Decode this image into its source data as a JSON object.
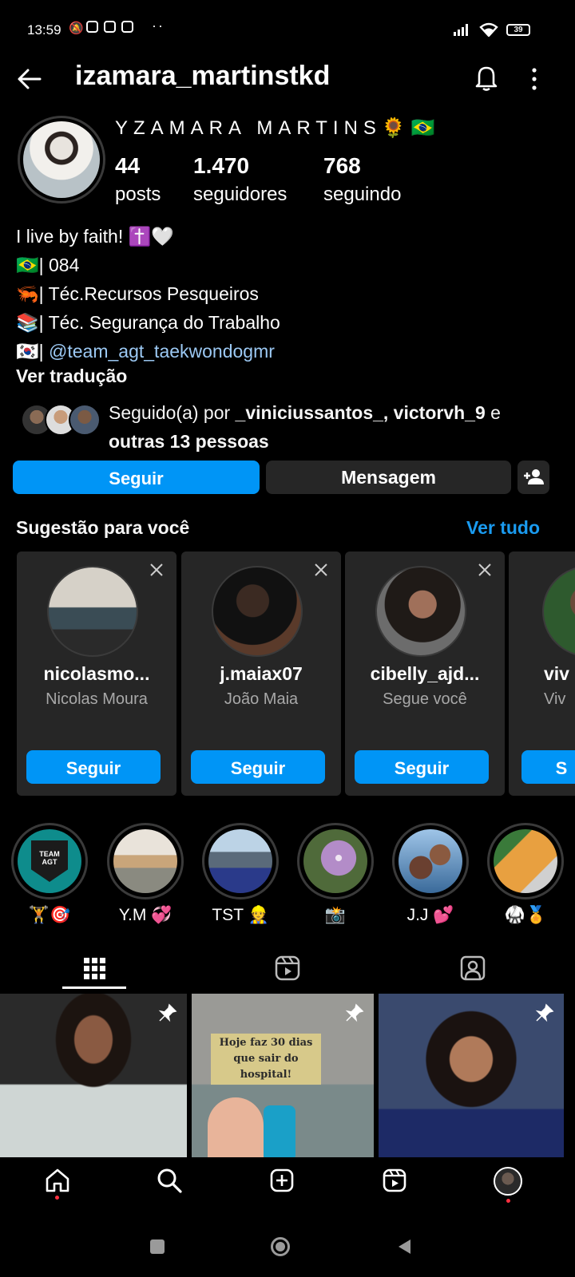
{
  "status": {
    "time": "13:59",
    "battery": "39",
    "dots": "··"
  },
  "header": {
    "username": "izamara_martinstkd"
  },
  "profile": {
    "display_name": "YZAMARA MARTINS🌻🇧🇷",
    "stats": [
      {
        "value": "44",
        "label": "posts"
      },
      {
        "value": "1.470",
        "label": "seguidores"
      },
      {
        "value": "768",
        "label": "seguindo"
      }
    ],
    "bio": {
      "line1": "I live by faith! ✝️🤍",
      "line2": "🇧🇷| 084",
      "line3": "🦐| Téc.Recursos Pesqueiros",
      "line4": "📚| Téc. Segurança do Trabalho",
      "line5_prefix": "🇰🇷| ",
      "line5_link": "@team_agt_taekwondogmr"
    },
    "translate": "Ver tradução",
    "followed_by": {
      "prefix": "Seguido(a) por ",
      "names": "_viniciussantos_, victorvh_9",
      "joiner": " e ",
      "others": "outras 13 pessoas"
    }
  },
  "actions": {
    "follow": "Seguir",
    "message": "Mensagem"
  },
  "suggestions": {
    "title": "Sugestão para você",
    "see_all": "Ver tudo",
    "cards": [
      {
        "username": "nicolasmo...",
        "subtitle": "Nicolas Moura",
        "button": "Seguir"
      },
      {
        "username": "j.maiax07",
        "subtitle": "João Maia",
        "button": "Seguir"
      },
      {
        "username": "cibelly_ajd...",
        "subtitle": "Segue você",
        "button": "Seguir"
      },
      {
        "username": "viv",
        "subtitle": "Viv",
        "button": "S"
      }
    ]
  },
  "highlights": [
    {
      "label": "🏋️🎯",
      "logo": "TEAM AGT"
    },
    {
      "label": "Y.M 💞"
    },
    {
      "label": "TST 👷"
    },
    {
      "label": "📸"
    },
    {
      "label": "J.J 💕"
    },
    {
      "label": "🥋🏅"
    }
  ],
  "posts": [
    {
      "overlay": ""
    },
    {
      "overlay": "Hoje faz 30 dias que sair do hospital!"
    },
    {
      "overlay": ""
    }
  ],
  "colors": {
    "accent": "#0095f6",
    "link": "#9cc9f4",
    "card_bg": "#262626",
    "background": "#000000"
  }
}
